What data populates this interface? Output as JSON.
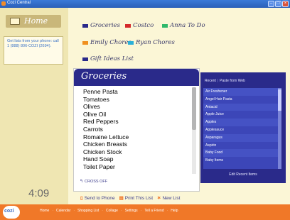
{
  "window": {
    "title": "Cozi Central"
  },
  "sidebar": {
    "home_label": "Home",
    "info_text": "Get lists from your phone: call 1 (888) 806-COZI (2694).",
    "clock": "4:09"
  },
  "list_tabs": [
    {
      "label": "Groceries",
      "color": "#2a2a8a"
    },
    {
      "label": "Costco",
      "color": "#d42a2a"
    },
    {
      "label": "Anna To Do",
      "color": "#2fb86a"
    },
    {
      "label": "Emily Chores",
      "color": "#f0901f"
    },
    {
      "label": "Ryan Chores",
      "color": "#2ab0d8"
    },
    {
      "label": "Gift Ideas List",
      "color": "#2a2a8a"
    }
  ],
  "groceries": {
    "title": "Groceries",
    "items": [
      "Penne Pasta",
      "Tomatoes",
      "Olives",
      "Olive Oil",
      "Red Peppers",
      "Carrots",
      "Romaine Lettuce",
      "Chicken Breasts",
      "Chicken Stock",
      "Hand Soap",
      "Toilet Paper"
    ],
    "cross_off_label": "CROSS OFF"
  },
  "recent": {
    "tab_recent": "Recent",
    "tab_paste": "Paste from Web",
    "items": [
      "Air Freshener",
      "Angel Hair Pasta",
      "Antacid",
      "Apple Juice",
      "Apples",
      "Applesauce",
      "Asparagus",
      "Aspirin",
      "Baby Food",
      "Baby Items"
    ],
    "edit_label": "Edit Recent Items"
  },
  "actions": {
    "send_to_phone": "Send to Phone",
    "print_list": "Print This List",
    "new_list": "New List"
  },
  "nav": {
    "logo": "cozi",
    "items": [
      "Home",
      "Calendar",
      "Shopping List",
      "Collage",
      "Settings",
      "Tell a Friend",
      "Help"
    ]
  }
}
